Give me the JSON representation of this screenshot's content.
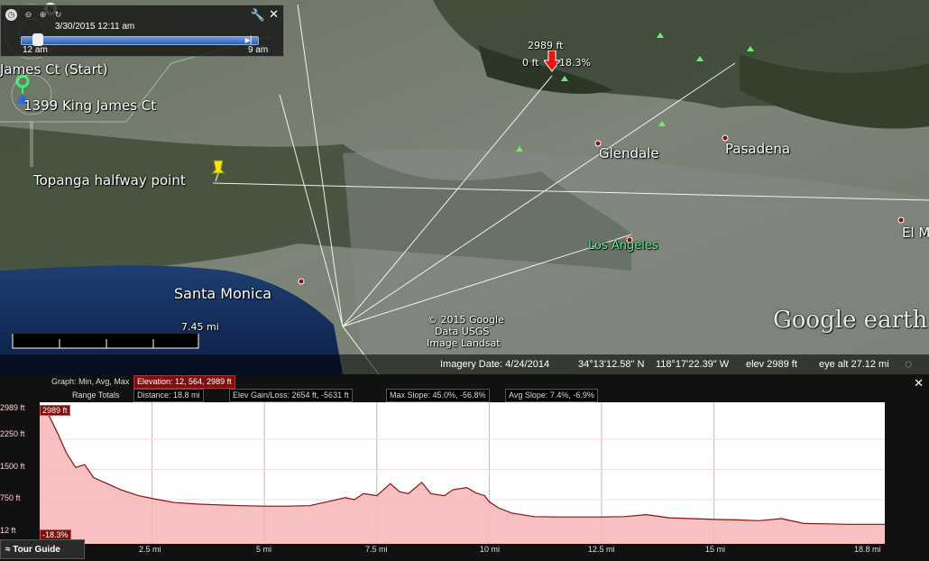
{
  "time_slider": {
    "date": "3/30/2015  12:11 am",
    "start": "12 am",
    "end": "9 am"
  },
  "map": {
    "places": {
      "start": "James Ct (Start)",
      "address": "1399 King James Ct",
      "halfway": "Topanga halfway point",
      "glendale": "Glendale",
      "pasadena": "Pasadena",
      "los_angeles": "Los Angeles",
      "santa_monica": "Santa Monica",
      "el_monte": "El M"
    },
    "peak": {
      "elevation": "2989 ft",
      "readout": "0 ft",
      "slope": "-18.3%"
    },
    "scale": "7.45 mi",
    "credits": [
      "© 2015 Google",
      "Data USGS",
      "Image Landsat"
    ],
    "brand": "Google earth"
  },
  "status_bar": {
    "imagery_date": "Imagery Date: 4/24/2014",
    "lat": "34°13'12.58\" N",
    "lon": "118°17'22.39\" W",
    "elev": "elev  2989 ft",
    "eye_alt": "eye alt  27.12 mi"
  },
  "profile": {
    "graph_label": "Graph: Min, Avg, Max",
    "elevation": "Elevation: 12, 564, 2989 ft",
    "range_label": "Range Totals",
    "distance": "Distance: 18.8 mi",
    "elev_gain": "Elev Gain/Loss: 2654 ft, -5631 ft",
    "max_slope": "Max Slope: 45.0%, -56.8%",
    "avg_slope": "Avg Slope: 7.4%, -6.9%",
    "max_tag": "2989 ft",
    "min_tag": "-18.3%",
    "tour_guide": "Tour Guide"
  },
  "chart_data": {
    "type": "area",
    "ylim": [
      12,
      2989
    ],
    "xlim": [
      0,
      18.8
    ],
    "yticks": [
      "2989 ft",
      "2250 ft",
      "1500 ft",
      "750 ft",
      "12 ft"
    ],
    "xticks": [
      "2.5 mi",
      "5 mi",
      "7.5 mi",
      "10 mi",
      "12.5 mi",
      "15 mi",
      "18.8 mi"
    ],
    "x": [
      0,
      0.2,
      0.4,
      0.6,
      0.8,
      1.0,
      1.2,
      1.5,
      1.8,
      2.2,
      2.6,
      3.0,
      3.5,
      4.0,
      4.5,
      5.0,
      5.5,
      6.0,
      6.4,
      6.8,
      7.0,
      7.2,
      7.5,
      7.8,
      8.0,
      8.2,
      8.5,
      8.7,
      9.0,
      9.2,
      9.5,
      9.7,
      9.9,
      10.0,
      10.2,
      10.5,
      11.0,
      11.5,
      12.0,
      12.5,
      13.0,
      13.5,
      14.0,
      14.5,
      15.0,
      15.5,
      16.0,
      16.5,
      17.0,
      17.5,
      18.0,
      18.8
    ],
    "y": [
      2989,
      2850,
      2400,
      1900,
      1550,
      1620,
      1300,
      1150,
      1000,
      850,
      760,
      680,
      640,
      620,
      600,
      590,
      590,
      600,
      700,
      800,
      750,
      900,
      850,
      1150,
      950,
      900,
      1180,
      900,
      850,
      1000,
      1050,
      920,
      850,
      700,
      550,
      420,
      330,
      320,
      320,
      320,
      330,
      380,
      300,
      280,
      260,
      250,
      230,
      280,
      160,
      150,
      140,
      140
    ]
  }
}
